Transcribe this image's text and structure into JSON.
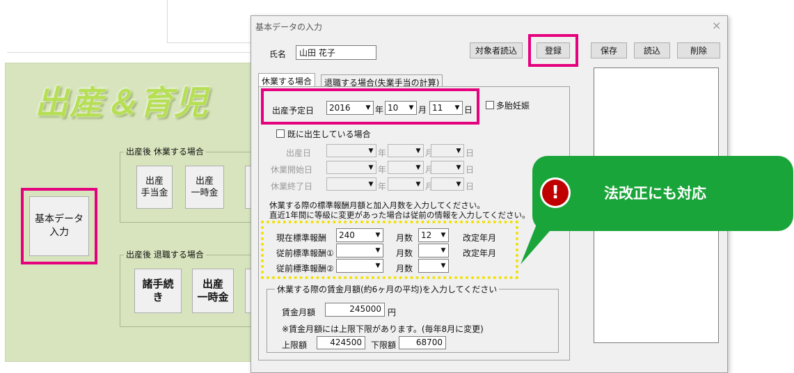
{
  "main": {
    "logo_text": "出産＆育児",
    "basic_data_button": "基本データ\n入力",
    "group_leave": {
      "label": "出産後  休業する場合",
      "buttons": [
        "出産\n手当金",
        "出産\n一時金"
      ]
    },
    "group_retire": {
      "label": "出産後  退職する場合",
      "buttons": [
        "諸手続\nき",
        "出産\n一時金"
      ]
    }
  },
  "dialog": {
    "title": "基本データの入力",
    "close_glyph": "×",
    "name_label": "氏名",
    "name_value": "山田  花子",
    "load_target_button": "対象者読込",
    "register_button": "登録",
    "save_button": "保存",
    "load_button": "読込",
    "delete_button": "削除",
    "tabs": [
      "休業する場合",
      "退職する場合(失業手当の計算)"
    ],
    "due_date": {
      "label": "出産予定日",
      "year": "2016",
      "year_unit": "年",
      "month": "10",
      "month_unit": "月",
      "day": "11",
      "day_unit": "日",
      "multiple_pregnancy_label": "多胎妊娠"
    },
    "already_born_label": "既に出生している場合",
    "disabled_rows": [
      {
        "label": "出産日"
      },
      {
        "label": "休業開始日"
      },
      {
        "label": "休業終了日"
      }
    ],
    "unit_year": "年",
    "unit_month": "月",
    "unit_day": "日",
    "instruction_line1": "休業する際の標準報酬月額と加入月数を入力してください。",
    "instruction_line2": "直近1年間に等級に変更があった場合は従前の情報を入力してください。",
    "salary_rows": [
      {
        "label": "現在標準報酬",
        "value": "240",
        "months_label": "月数",
        "months": "12",
        "revision_label": "改定年月"
      },
      {
        "label": "従前標準報酬①",
        "value": "",
        "months_label": "月数",
        "months": "",
        "revision_label": "改定年月"
      },
      {
        "label": "従前標準報酬②",
        "value": "",
        "months_label": "月数",
        "months": ""
      }
    ],
    "wage_group": {
      "label": "休業する際の賃金月額(約6ヶ月の平均)を入力してください",
      "wage_label": "賃金月額",
      "wage_value": "245000",
      "wage_unit": "円",
      "note": "※賃金月額には上限下限があります。(毎年8月に変更)",
      "upper_label": "上限額",
      "upper_value": "424500",
      "lower_label": "下限額",
      "lower_value": "68700"
    }
  },
  "callout": {
    "text": "法改正にも対応",
    "icon": "exclamation-icon",
    "icon_glyph": "!"
  },
  "colors": {
    "highlight": "#e5007e",
    "dotted": "#f1e100",
    "callout": "#1aa53a",
    "panel": "#d7e4bd",
    "logo": "#b6df55"
  }
}
